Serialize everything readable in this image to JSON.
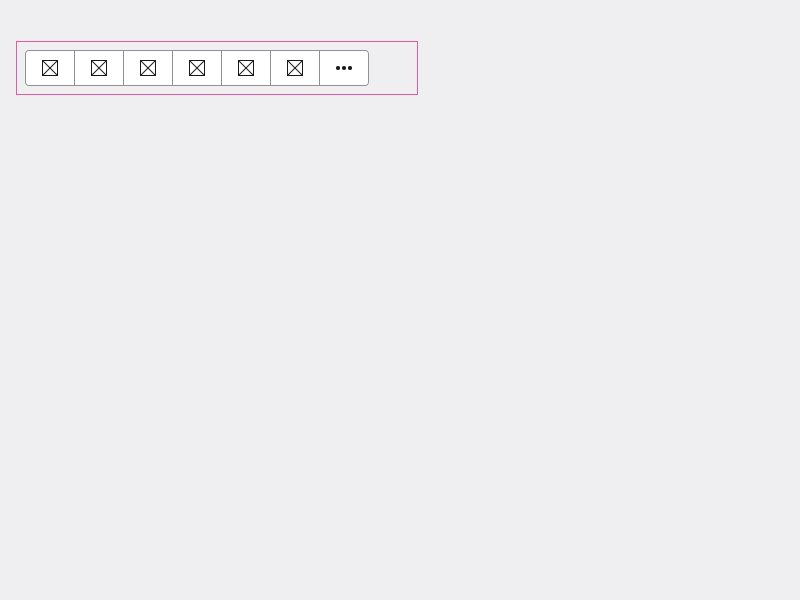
{
  "toolbar": {
    "buttons": [
      {
        "icon": "placeholder-icon"
      },
      {
        "icon": "placeholder-icon"
      },
      {
        "icon": "placeholder-icon"
      },
      {
        "icon": "placeholder-icon"
      },
      {
        "icon": "placeholder-icon"
      },
      {
        "icon": "placeholder-icon"
      }
    ],
    "overflow": {
      "icon": "more-horizontal-icon"
    }
  },
  "colors": {
    "background": "#efeff1",
    "frame_border": "#e85aa0",
    "toolbar_border": "#8f8f95",
    "icon": "#1a1a1a"
  }
}
